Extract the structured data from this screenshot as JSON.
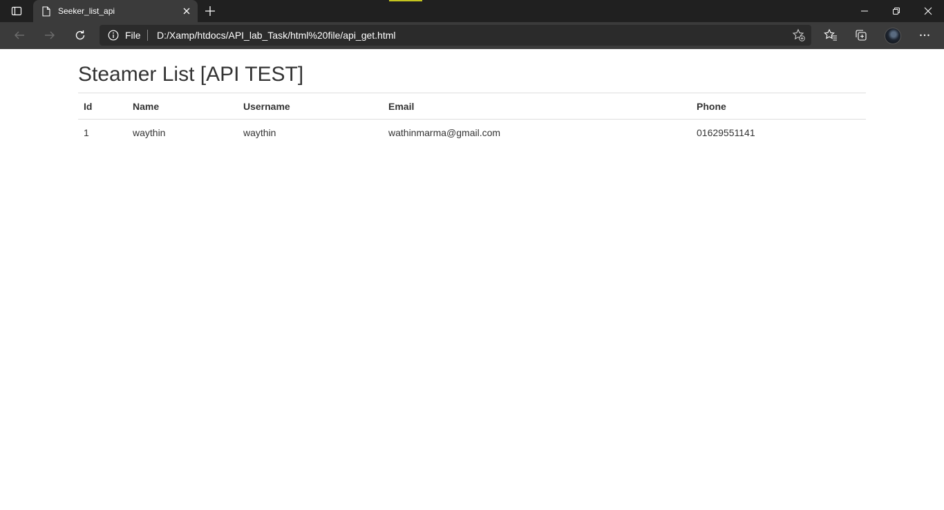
{
  "browser": {
    "tab": {
      "title": "Seeker_list_api"
    },
    "address_bar": {
      "scheme_label": "File",
      "url": "D:/Xamp/htdocs/API_lab_Task/html%20file/api_get.html"
    },
    "icons": {
      "tab_actions": "tab-actions-icon",
      "favicon": "page-icon",
      "tab_close": "close-icon",
      "new_tab": "plus-icon",
      "minimize": "minimize-icon",
      "restore": "restore-icon",
      "close_window": "close-icon",
      "back": "arrow-left-icon",
      "forward": "arrow-right-icon",
      "refresh": "refresh-icon",
      "site_info": "info-icon",
      "add_favorite": "star-plus-icon",
      "favorites": "favorites-icon",
      "collections": "collections-icon",
      "more": "more-icon"
    },
    "colors": {
      "titlebar": "#202020",
      "toolbar": "#3b3b3b",
      "accent": "#c5c51f"
    }
  },
  "page": {
    "title": "Steamer List [API TEST]",
    "table": {
      "headers": [
        "Id",
        "Name",
        "Username",
        "Email",
        "Phone"
      ],
      "rows": [
        [
          "1",
          "waythin",
          "waythin",
          "wathinmarma@gmail.com",
          "01629551141"
        ]
      ]
    }
  }
}
